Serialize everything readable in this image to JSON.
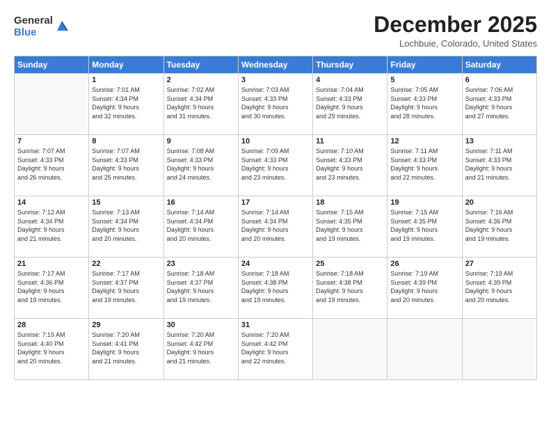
{
  "logo": {
    "general": "General",
    "blue": "Blue"
  },
  "title": "December 2025",
  "location": "Lochbuie, Colorado, United States",
  "days_of_week": [
    "Sunday",
    "Monday",
    "Tuesday",
    "Wednesday",
    "Thursday",
    "Friday",
    "Saturday"
  ],
  "weeks": [
    [
      {
        "day": "",
        "info": ""
      },
      {
        "day": "1",
        "info": "Sunrise: 7:01 AM\nSunset: 4:34 PM\nDaylight: 9 hours\nand 32 minutes."
      },
      {
        "day": "2",
        "info": "Sunrise: 7:02 AM\nSunset: 4:34 PM\nDaylight: 9 hours\nand 31 minutes."
      },
      {
        "day": "3",
        "info": "Sunrise: 7:03 AM\nSunset: 4:33 PM\nDaylight: 9 hours\nand 30 minutes."
      },
      {
        "day": "4",
        "info": "Sunrise: 7:04 AM\nSunset: 4:33 PM\nDaylight: 9 hours\nand 29 minutes."
      },
      {
        "day": "5",
        "info": "Sunrise: 7:05 AM\nSunset: 4:33 PM\nDaylight: 9 hours\nand 28 minutes."
      },
      {
        "day": "6",
        "info": "Sunrise: 7:06 AM\nSunset: 4:33 PM\nDaylight: 9 hours\nand 27 minutes."
      }
    ],
    [
      {
        "day": "7",
        "info": "Sunrise: 7:07 AM\nSunset: 4:33 PM\nDaylight: 9 hours\nand 26 minutes."
      },
      {
        "day": "8",
        "info": "Sunrise: 7:07 AM\nSunset: 4:33 PM\nDaylight: 9 hours\nand 25 minutes."
      },
      {
        "day": "9",
        "info": "Sunrise: 7:08 AM\nSunset: 4:33 PM\nDaylight: 9 hours\nand 24 minutes."
      },
      {
        "day": "10",
        "info": "Sunrise: 7:09 AM\nSunset: 4:33 PM\nDaylight: 9 hours\nand 23 minutes."
      },
      {
        "day": "11",
        "info": "Sunrise: 7:10 AM\nSunset: 4:33 PM\nDaylight: 9 hours\nand 23 minutes."
      },
      {
        "day": "12",
        "info": "Sunrise: 7:11 AM\nSunset: 4:33 PM\nDaylight: 9 hours\nand 22 minutes."
      },
      {
        "day": "13",
        "info": "Sunrise: 7:11 AM\nSunset: 4:33 PM\nDaylight: 9 hours\nand 21 minutes."
      }
    ],
    [
      {
        "day": "14",
        "info": "Sunrise: 7:12 AM\nSunset: 4:34 PM\nDaylight: 9 hours\nand 21 minutes."
      },
      {
        "day": "15",
        "info": "Sunrise: 7:13 AM\nSunset: 4:34 PM\nDaylight: 9 hours\nand 20 minutes."
      },
      {
        "day": "16",
        "info": "Sunrise: 7:14 AM\nSunset: 4:34 PM\nDaylight: 9 hours\nand 20 minutes."
      },
      {
        "day": "17",
        "info": "Sunrise: 7:14 AM\nSunset: 4:34 PM\nDaylight: 9 hours\nand 20 minutes."
      },
      {
        "day": "18",
        "info": "Sunrise: 7:15 AM\nSunset: 4:35 PM\nDaylight: 9 hours\nand 19 minutes."
      },
      {
        "day": "19",
        "info": "Sunrise: 7:15 AM\nSunset: 4:35 PM\nDaylight: 9 hours\nand 19 minutes."
      },
      {
        "day": "20",
        "info": "Sunrise: 7:16 AM\nSunset: 4:36 PM\nDaylight: 9 hours\nand 19 minutes."
      }
    ],
    [
      {
        "day": "21",
        "info": "Sunrise: 7:17 AM\nSunset: 4:36 PM\nDaylight: 9 hours\nand 19 minutes."
      },
      {
        "day": "22",
        "info": "Sunrise: 7:17 AM\nSunset: 4:37 PM\nDaylight: 9 hours\nand 19 minutes."
      },
      {
        "day": "23",
        "info": "Sunrise: 7:18 AM\nSunset: 4:37 PM\nDaylight: 9 hours\nand 19 minutes."
      },
      {
        "day": "24",
        "info": "Sunrise: 7:18 AM\nSunset: 4:38 PM\nDaylight: 9 hours\nand 19 minutes."
      },
      {
        "day": "25",
        "info": "Sunrise: 7:18 AM\nSunset: 4:38 PM\nDaylight: 9 hours\nand 19 minutes."
      },
      {
        "day": "26",
        "info": "Sunrise: 7:19 AM\nSunset: 4:39 PM\nDaylight: 9 hours\nand 20 minutes."
      },
      {
        "day": "27",
        "info": "Sunrise: 7:19 AM\nSunset: 4:39 PM\nDaylight: 9 hours\nand 20 minutes."
      }
    ],
    [
      {
        "day": "28",
        "info": "Sunrise: 7:19 AM\nSunset: 4:40 PM\nDaylight: 9 hours\nand 20 minutes."
      },
      {
        "day": "29",
        "info": "Sunrise: 7:20 AM\nSunset: 4:41 PM\nDaylight: 9 hours\nand 21 minutes."
      },
      {
        "day": "30",
        "info": "Sunrise: 7:20 AM\nSunset: 4:42 PM\nDaylight: 9 hours\nand 21 minutes."
      },
      {
        "day": "31",
        "info": "Sunrise: 7:20 AM\nSunset: 4:42 PM\nDaylight: 9 hours\nand 22 minutes."
      },
      {
        "day": "",
        "info": ""
      },
      {
        "day": "",
        "info": ""
      },
      {
        "day": "",
        "info": ""
      }
    ]
  ]
}
